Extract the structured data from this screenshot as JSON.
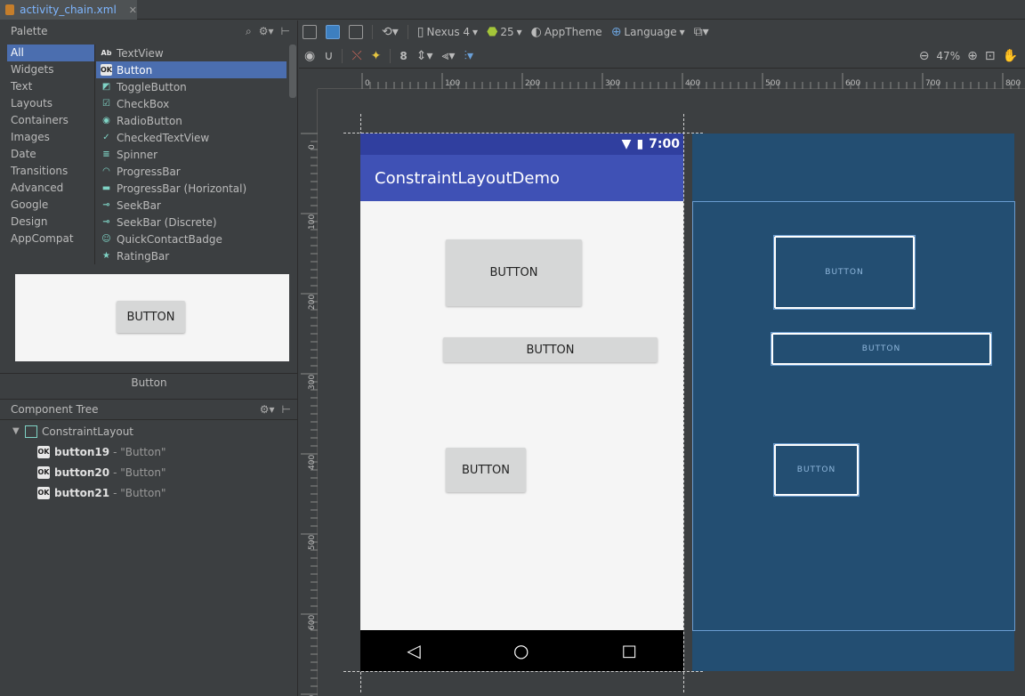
{
  "tab": {
    "file_name": "activity_chain.xml"
  },
  "palette": {
    "title": "Palette",
    "categories": [
      "All",
      "Widgets",
      "Text",
      "Layouts",
      "Containers",
      "Images",
      "Date",
      "Transitions",
      "Advanced",
      "Google",
      "Design",
      "AppCompat"
    ],
    "items": [
      {
        "icon": "Ab",
        "label": "TextView"
      },
      {
        "icon": "OK",
        "label": "Button"
      },
      {
        "icon": "◩",
        "label": "ToggleButton"
      },
      {
        "icon": "☑",
        "label": "CheckBox"
      },
      {
        "icon": "◉",
        "label": "RadioButton"
      },
      {
        "icon": "✓",
        "label": "CheckedTextView"
      },
      {
        "icon": "≡",
        "label": "Spinner"
      },
      {
        "icon": "◠",
        "label": "ProgressBar"
      },
      {
        "icon": "▬",
        "label": "ProgressBar (Horizontal)"
      },
      {
        "icon": "⊸",
        "label": "SeekBar"
      },
      {
        "icon": "⊸",
        "label": "SeekBar (Discrete)"
      },
      {
        "icon": "☺",
        "label": "QuickContactBadge"
      },
      {
        "icon": "★",
        "label": "RatingBar"
      }
    ],
    "preview_button": "BUTTON",
    "preview_caption": "Button"
  },
  "component_tree": {
    "title": "Component Tree",
    "root": "ConstraintLayout",
    "children": [
      {
        "id": "button19",
        "text": "- \"Button\""
      },
      {
        "id": "button20",
        "text": "- \"Button\""
      },
      {
        "id": "button21",
        "text": "- \"Button\""
      }
    ]
  },
  "toolbar": {
    "device": "Nexus 4",
    "api": "25",
    "theme": "AppTheme",
    "language": "Language",
    "margin": "8",
    "zoom": "47%"
  },
  "ruler": {
    "h": [
      "0",
      "100",
      "200",
      "300",
      "400",
      "500",
      "600",
      "700",
      "800"
    ],
    "v": [
      "0",
      "100",
      "200",
      "300",
      "400",
      "500",
      "600",
      "700"
    ]
  },
  "phone": {
    "time": "7:00",
    "app_title": "ConstraintLayoutDemo",
    "buttons": [
      "BUTTON",
      "BUTTON",
      "BUTTON"
    ]
  },
  "blueprint": {
    "buttons": [
      "BUTTON",
      "BUTTON",
      "BUTTON"
    ]
  },
  "colors": {
    "selection": "#4b6eaf",
    "app_bar": "#3f51b5",
    "status_bar": "#303f9f",
    "blueprint": "#234e72"
  }
}
